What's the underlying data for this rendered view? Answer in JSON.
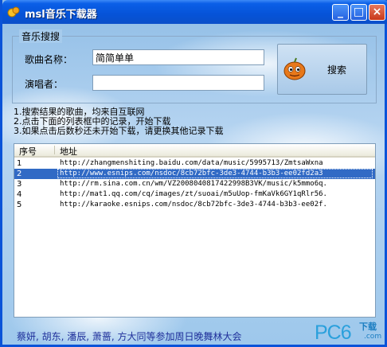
{
  "window": {
    "title": "msl音乐下载器"
  },
  "titlebar_buttons": {
    "minimize": "_",
    "maximize": "□",
    "close": "×"
  },
  "search_group": {
    "label": "音乐搜搜",
    "song_label": "歌曲名称：",
    "song_value": "简简单单",
    "singer_label": "演唱者：",
    "singer_value": "",
    "search_button": "搜索"
  },
  "instructions": [
    "1.搜索结果的歌曲，均来自互联网",
    "2.点击下面的列表框中的记录，开始下载",
    "3.如果点击后数秒还未开始下载，请更换其他记录下载"
  ],
  "list": {
    "headers": [
      "序号",
      "地址"
    ],
    "rows": [
      {
        "no": "1",
        "url": "http://zhangmenshiting.baidu.com/data/music/5995713/ZmtsaWxna"
      },
      {
        "no": "2",
        "url": "http://www.esnips.com/nsdoc/8cb72bfc-3de3-4744-b3b3-ee02fd2a3"
      },
      {
        "no": "3",
        "url": "http://rm.sina.com.cn/wm/VZ2008040817422998B3VK/music/k5mmo6q."
      },
      {
        "no": "4",
        "url": "http://mat1.qq.com/cq/images/zt/suoai/m5uUop-fmKaVk6GY1qRlr56."
      },
      {
        "no": "5",
        "url": "http://karaoke.esnips.com/nsdoc/8cb72bfc-3de3-4744-b3b3-ee02f."
      }
    ],
    "selected_index": 1
  },
  "marquee": "蔡妍, 胡东, 潘辰, 萧蔷, 方大同等参加周日晚舞林大会",
  "watermark": {
    "brand": "PC6",
    "sub": "下载",
    "dotcom": ".com"
  },
  "colors": {
    "titlebar": "#0653d8",
    "selection": "#316ac5",
    "watermark": "#2aa0dc"
  }
}
